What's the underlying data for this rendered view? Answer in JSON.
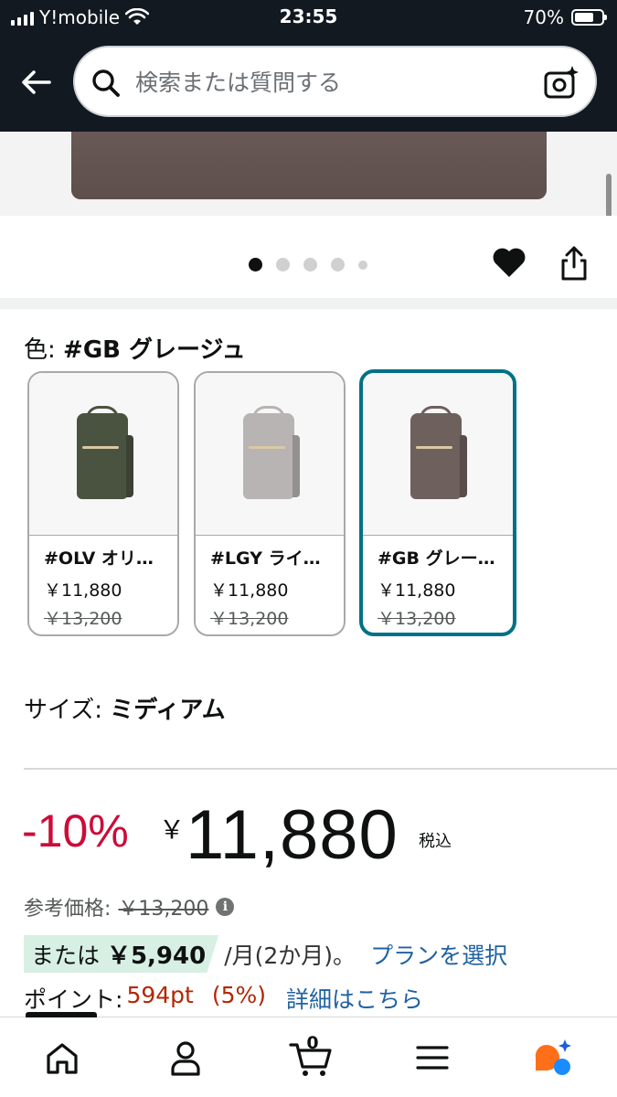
{
  "status_bar": {
    "carrier": "Y!mobile",
    "time": "23:55",
    "battery": "70%",
    "battery_level": 0.7
  },
  "header": {
    "search_placeholder": "検索または質問する",
    "icons": [
      "back-arrow-icon",
      "search-icon",
      "camera-search-icon"
    ]
  },
  "carousel": {
    "dot_count": 5,
    "active_index": 0
  },
  "color_selection": {
    "label": "色: ",
    "selected": "#GB グレージュ",
    "options": [
      {
        "name": "#OLV オリ…",
        "price": "￥11,880",
        "list_price": "￥13,200",
        "color": "#4a5340"
      },
      {
        "name": "#LGY ライ…",
        "price": "￥11,880",
        "list_price": "￥13,200",
        "color": "#b8b4b3"
      },
      {
        "name": "#GB グレー…",
        "price": "￥11,880",
        "list_price": "￥13,200",
        "color": "#6e605d"
      }
    ]
  },
  "size_selection": {
    "label": "サイズ: ",
    "selected": "ミディアム"
  },
  "pricing": {
    "discount": "-10%",
    "currency": "￥",
    "price": "11,880",
    "tax_note": "税込",
    "reference_label": "参考価格:",
    "reference_price": "￥13,200",
    "installment_prefix": "または",
    "installment_amount": "￥5,940",
    "installment_suffix": "/月(2か月)。",
    "plan_link": "プランを選択",
    "points_label": "ポイント:",
    "points_value": "594pt",
    "points_percent": "(5%)",
    "points_link": "詳細はこちら"
  },
  "bottom_nav": {
    "cart_count": "0",
    "items": [
      "home-icon",
      "account-icon",
      "cart-icon",
      "menu-icon",
      "rufus-assistant-icon"
    ]
  },
  "colors": {
    "header_bg": "#131921",
    "selected_border": "#007185",
    "discount_red": "#cc0c39",
    "link_blue": "#2162a1",
    "highlight_green": "#d7f0e3"
  }
}
